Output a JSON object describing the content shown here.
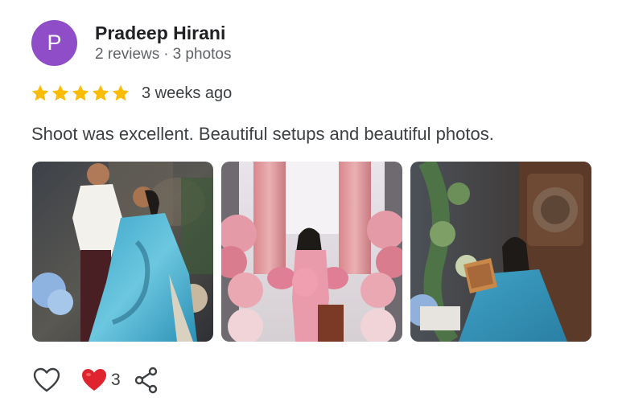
{
  "reviewer": {
    "initial": "P",
    "name": "Pradeep Hirani",
    "reviews": "2 reviews",
    "separator": "·",
    "photos": "3 photos",
    "avatar_color": "#8f4ec7"
  },
  "rating": {
    "stars": 5,
    "time": "3 weeks ago",
    "star_color": "#fbbc04"
  },
  "review_text": "Shoot was excellent. Beautiful setups and beautiful photos.",
  "photos": [
    {
      "name": "photo-couple-maternity"
    },
    {
      "name": "photo-pink-gown-maternity"
    },
    {
      "name": "photo-reading-book-maternity"
    }
  ],
  "actions": {
    "like_icon": "heart-outline-icon",
    "reaction_icon": "red-heart-icon",
    "reaction_count": "3",
    "share_icon": "share-icon"
  }
}
